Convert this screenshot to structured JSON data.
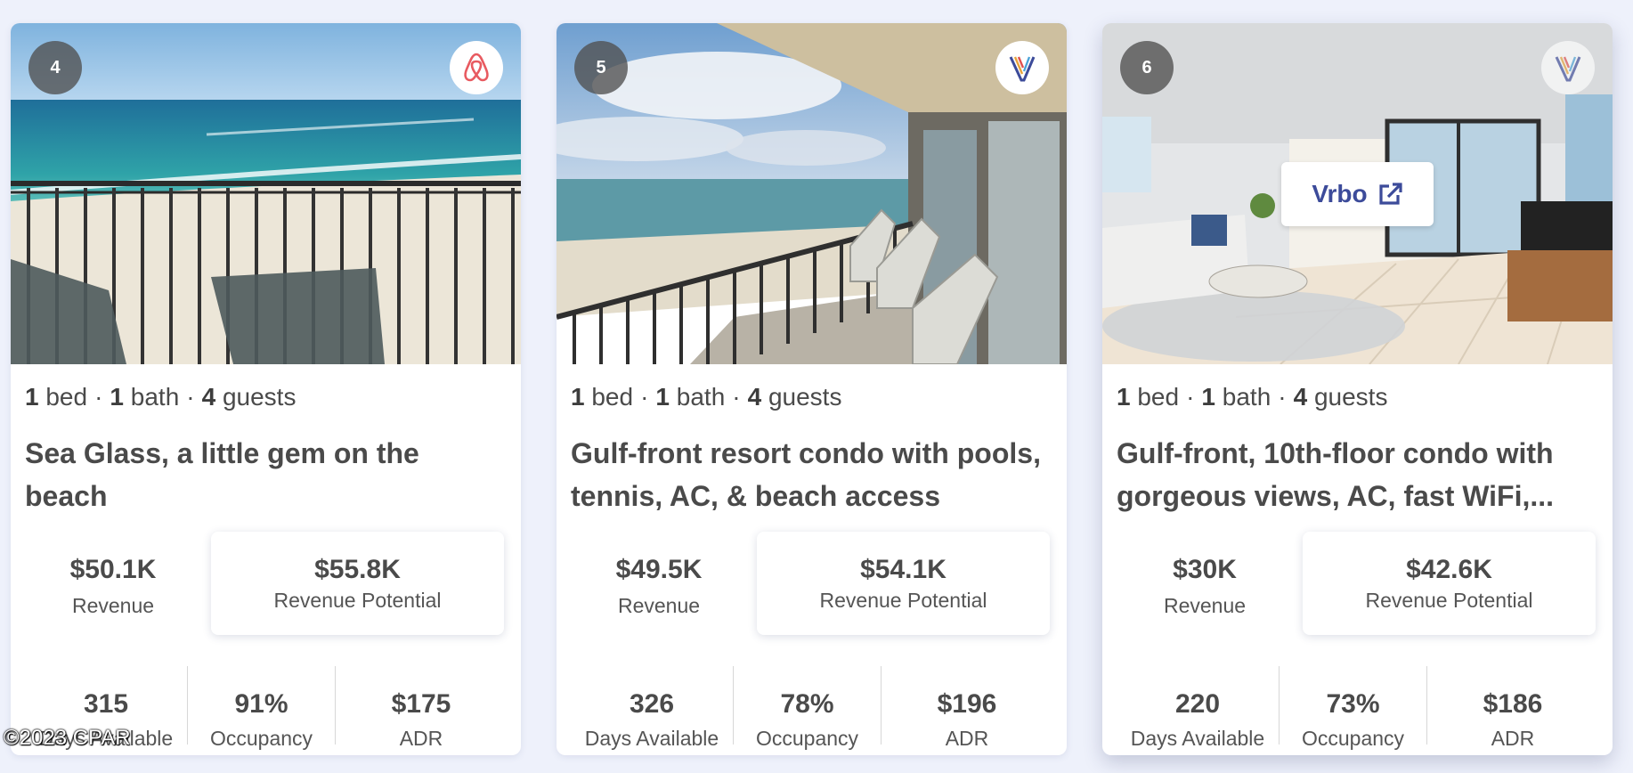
{
  "cards": [
    {
      "number": "4",
      "platform": "airbnb",
      "platform_icon": "airbnb-logo-icon",
      "beds": "1",
      "beds_label": "bed",
      "baths": "1",
      "baths_label": "bath",
      "guests": "4",
      "guests_label": "guests",
      "title": "Sea Glass, a little gem on the beach",
      "revenue": "$50.1K",
      "revenue_label": "Revenue",
      "revenue_potential": "$55.8K",
      "revenue_potential_label": "Revenue Potential",
      "days_available": "315",
      "days_available_label": "Days Available",
      "occupancy": "91%",
      "occupancy_label": "Occupancy",
      "adr": "$175",
      "adr_label": "ADR"
    },
    {
      "number": "5",
      "platform": "vrbo",
      "platform_icon": "vrbo-logo-icon",
      "beds": "1",
      "beds_label": "bed",
      "baths": "1",
      "baths_label": "bath",
      "guests": "4",
      "guests_label": "guests",
      "title": "Gulf-front resort condo with pools, tennis, AC, & beach access",
      "revenue": "$49.5K",
      "revenue_label": "Revenue",
      "revenue_potential": "$54.1K",
      "revenue_potential_label": "Revenue Potential",
      "days_available": "326",
      "days_available_label": "Days Available",
      "occupancy": "78%",
      "occupancy_label": "Occupancy",
      "adr": "$196",
      "adr_label": "ADR"
    },
    {
      "number": "6",
      "platform": "vrbo",
      "platform_icon": "vrbo-logo-icon",
      "hover_link_label": "Vrbo",
      "hover_link_icon": "external-link-icon",
      "beds": "1",
      "beds_label": "bed",
      "baths": "1",
      "baths_label": "bath",
      "guests": "4",
      "guests_label": "guests",
      "title": "Gulf-front, 10th-floor condo with gorgeous views, AC, fast WiFi,...",
      "revenue": "$30K",
      "revenue_label": "Revenue",
      "revenue_potential": "$42.6K",
      "revenue_potential_label": "Revenue Potential",
      "days_available": "220",
      "days_available_label": "Days Available",
      "occupancy": "73%",
      "occupancy_label": "Occupancy",
      "adr": "$186",
      "adr_label": "ADR"
    }
  ],
  "watermark": "©2023 CPAR",
  "colors": {
    "page_bg": "#eef1fb",
    "airbnb": "#e85a60",
    "vrbo_link": "#3c4b9a",
    "text": "#4a4a4a"
  }
}
